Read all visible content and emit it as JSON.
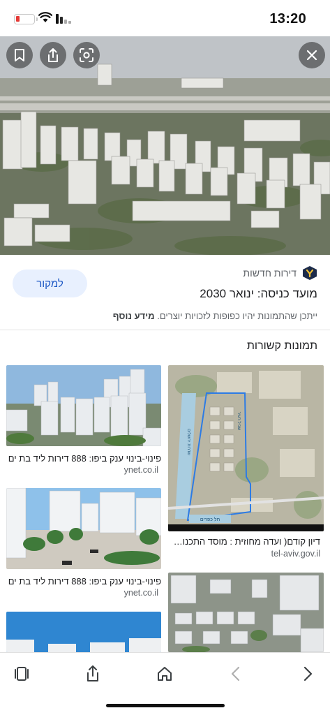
{
  "status": {
    "time": "13:20"
  },
  "hero": {
    "icons": [
      "bookmark-icon",
      "share-icon",
      "lens-icon",
      "close-icon"
    ]
  },
  "info": {
    "source_name": "דירות חדשות",
    "visit_button": "למקור",
    "title": "מועד כניסה: ינואר 2030",
    "copyright_text": "ייתכן שהתמונות יהיו כפופות לזכויות יוצרים.",
    "more_info": "מידע נוסף"
  },
  "related": {
    "heading": "תמונות קשורות",
    "cards": [
      {
        "title": "פינוי-בינוי ענק ביפו: 888 דירות ליד בת ים",
        "domain": "ynet.co.il"
      },
      {
        "title": "דיון קודם( ועדה מחוזית : מוסד התכנון המוס...",
        "domain": "tel-aviv.gov.il"
      },
      {
        "title": "פינוי-בינוי ענק ביפו: 888 דירות ליד בת ים",
        "domain": "ynet.co.il"
      }
    ],
    "map_labels": [
      "חל כפרים",
      "שדרות ירושלים",
      "שביל העיר"
    ]
  },
  "toolbar": {
    "icons": [
      "tabs-icon",
      "share-icon",
      "home-icon",
      "back-icon",
      "forward-icon"
    ]
  },
  "colors": {
    "accent": "#1a56c4",
    "visit_bg": "#e8f0fe",
    "battery_low": "#e53935"
  }
}
